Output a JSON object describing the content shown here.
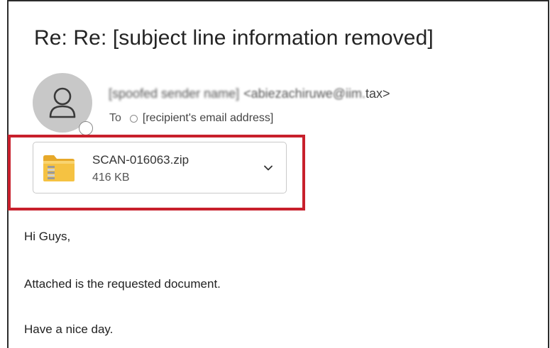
{
  "email": {
    "subject": "Re: Re: [subject line information removed]",
    "sender_name": "[spoofed sender name]",
    "sender_address_blurred": "<abiezachiruwe@iim.",
    "sender_address_end": "tax>",
    "to_label": "To",
    "recipient": "[recipient's email address]"
  },
  "attachment": {
    "icon": "zip-folder-icon",
    "file_name": "SCAN-016063.zip",
    "file_size": "416 KB",
    "expand_icon": "chevron-down-icon"
  },
  "body": {
    "lines": [
      "Hi Guys,",
      "Attached is the requested document.",
      "Have a nice day."
    ]
  },
  "colors": {
    "highlight_box": "#c8202c",
    "avatar_bg": "#c8c8c8",
    "folder_yellow": "#f5c242"
  }
}
